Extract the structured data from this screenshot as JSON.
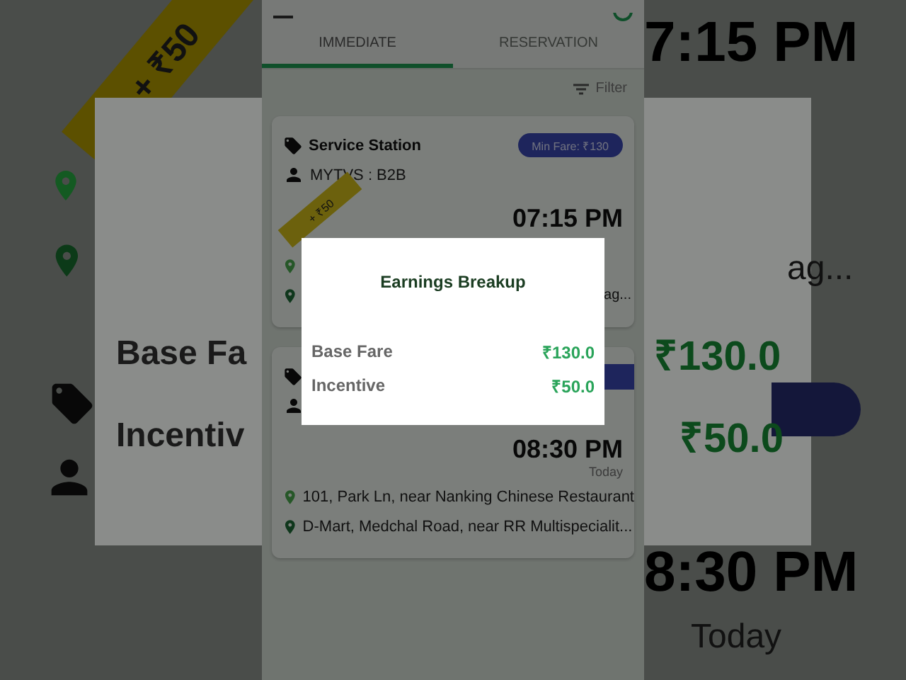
{
  "backdrop": {
    "tag": "+ ₹50",
    "texts": [
      {
        "kind": "time",
        "text": "7:15 PM"
      },
      {
        "kind": "sub",
        "text": "ag..."
      },
      {
        "kind": "label",
        "text": "Base Fa"
      },
      {
        "kind": "amount",
        "text": "₹130.0"
      },
      {
        "kind": "label",
        "text": "Incentiv"
      },
      {
        "kind": "amount",
        "text": "₹50.0"
      },
      {
        "kind": "time",
        "text": "8:30 PM"
      },
      {
        "kind": "sub",
        "text": "Today"
      }
    ]
  },
  "tabs": [
    {
      "label": "IMMEDIATE",
      "selected": true
    },
    {
      "label": "RESERVATION",
      "selected": false
    }
  ],
  "filter": {
    "label": "Filter"
  },
  "bookings": [
    {
      "category": "Service Station",
      "min_fare": "Min Fare: ₹130",
      "customer": "MYTVS : B2B",
      "incentive_tag": "+ ₹50",
      "time": "07:15 PM",
      "addresses": [
        {
          "kind": "pickup"
        },
        {
          "kind": "drop",
          "text": "ag..."
        }
      ]
    },
    {
      "time": "08:30 PM",
      "day": "Today",
      "addresses": [
        {
          "kind": "pickup",
          "text": "101, Park Ln, near Nanking Chinese Restaurant"
        },
        {
          "kind": "drop",
          "text": "D-Mart, Medchal Road, near RR Multispecialit..."
        }
      ]
    }
  ],
  "dialog": {
    "title": "Earnings Breakup",
    "rows": [
      {
        "label": "Base Fare",
        "amount": "₹130.0"
      },
      {
        "label": "Incentive",
        "amount": "₹50.0"
      }
    ]
  }
}
